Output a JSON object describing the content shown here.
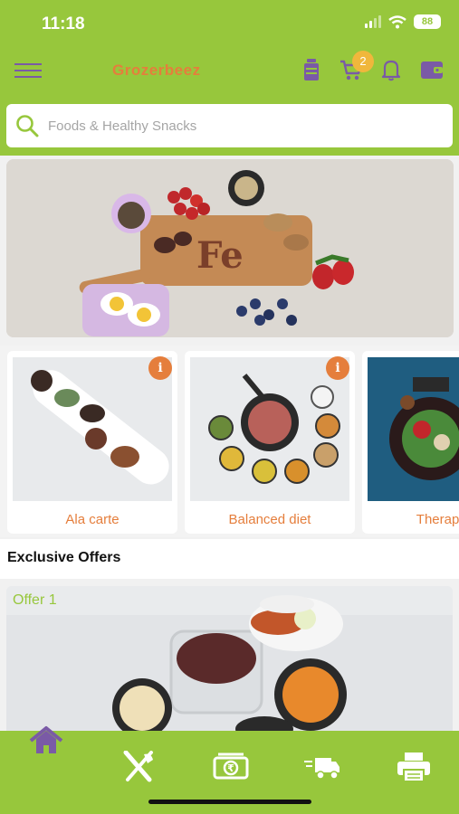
{
  "status": {
    "time": "11:18",
    "battery": "88"
  },
  "header": {
    "title": "Grozerbeez",
    "cart_count": "2"
  },
  "search": {
    "placeholder": "Foods & Healthy Snacks"
  },
  "banner": {
    "text": "Fe"
  },
  "categories": [
    {
      "label": "Ala carte",
      "info": "i"
    },
    {
      "label": "Balanced diet",
      "info": "i"
    },
    {
      "label": "Therapeut"
    }
  ],
  "offers": {
    "title": "Exclusive Offers",
    "items": [
      {
        "label": "Offer 1"
      }
    ]
  },
  "bottom_nav": [
    "home-icon",
    "dining-icon",
    "rupee-money-icon",
    "delivery-truck-icon",
    "printer-icon"
  ],
  "colors": {
    "brand_green": "#97c73c",
    "accent_orange": "#e57e3c",
    "icon_purple": "#7a5aa6",
    "badge_yellow": "#f0b73c"
  }
}
